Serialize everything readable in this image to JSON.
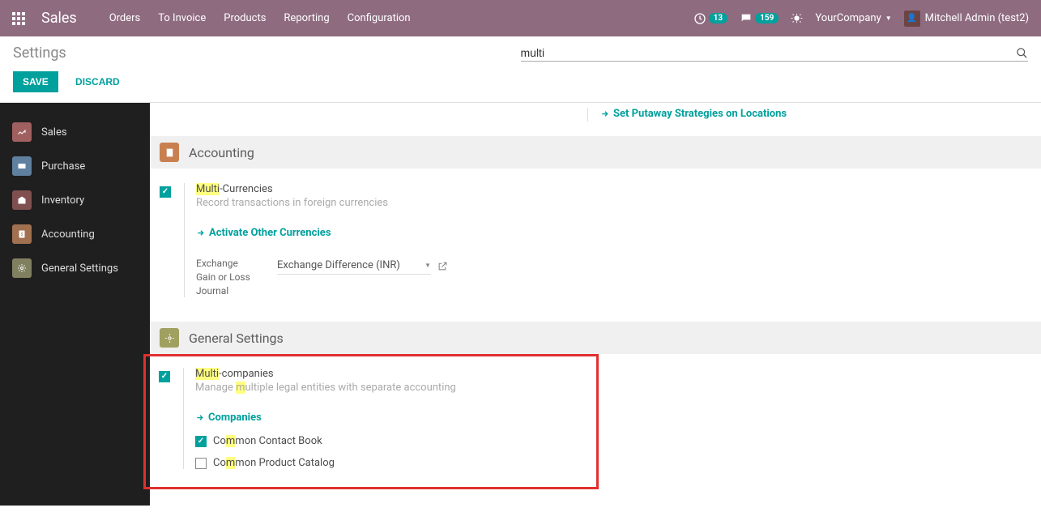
{
  "topbar": {
    "brand": "Sales",
    "menu": [
      "Orders",
      "To Invoice",
      "Products",
      "Reporting",
      "Configuration"
    ],
    "clock_badge": "13",
    "chat_badge": "159",
    "company": "YourCompany",
    "user": "Mitchell Admin (test2)"
  },
  "controls": {
    "page_title": "Settings",
    "save": "SAVE",
    "discard": "DISCARD",
    "search_value": "multi"
  },
  "sidebar": {
    "items": [
      {
        "label": "Sales",
        "icon": "sales"
      },
      {
        "label": "Purchase",
        "icon": "purchase"
      },
      {
        "label": "Inventory",
        "icon": "inventory"
      },
      {
        "label": "Accounting",
        "icon": "accounting"
      },
      {
        "label": "General Settings",
        "icon": "general"
      }
    ]
  },
  "top_link": {
    "label": "Set Putaway Strategies on Locations"
  },
  "accounting": {
    "header": "Accounting",
    "multi_curr": {
      "hl": "Multi",
      "rest": "-Currencies",
      "desc": "Record transactions in foreign currencies",
      "activate": "Activate Other Currencies",
      "field_label_l1": "Exchange",
      "field_label_l2": "Gain or Loss",
      "field_label_l3": "Journal",
      "field_value": "Exchange Difference (INR)"
    }
  },
  "general": {
    "header": "General Settings",
    "multi_comp": {
      "hl": "Multi",
      "rest": "-companies",
      "desc_p1": "Manage ",
      "desc_hl": "m",
      "desc_p2": "ultiple legal entities with separate accounting",
      "companies": "Companies",
      "opt1_p1": "Co",
      "opt1_hl": "m",
      "opt1_p2": "mon Contact Book",
      "opt2_p1": "Co",
      "opt2_hl": "m",
      "opt2_p2": "mon Product Catalog"
    }
  }
}
